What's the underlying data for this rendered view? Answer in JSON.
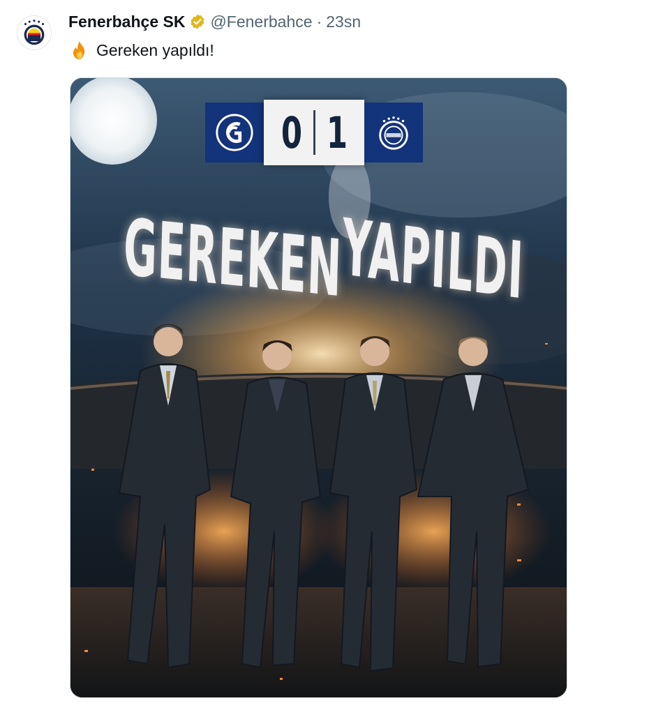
{
  "tweet": {
    "author": {
      "display_name": "Fenerbahçe SK",
      "handle": "@Fenerbahce",
      "separator": "·",
      "time": "23sn",
      "verified": true,
      "avatar_icon": "fenerbahce-crest-icon"
    },
    "text": "Gereken yapıldı!",
    "emoji_icon": "fire-icon"
  },
  "media": {
    "scoreboard": {
      "home_team_icon": "galatasaray-crest-icon",
      "home_score": "0",
      "away_score": "1",
      "away_team_icon": "fenerbahce-crest-icon"
    },
    "headline": {
      "word1": "GEREKEN",
      "word2": "YAPILDI"
    },
    "players_count": 4
  },
  "colors": {
    "text_primary": "#0f1419",
    "text_secondary": "#536471",
    "verified_badge": "#e2b719",
    "scoreboard_blue": "#13337a"
  }
}
